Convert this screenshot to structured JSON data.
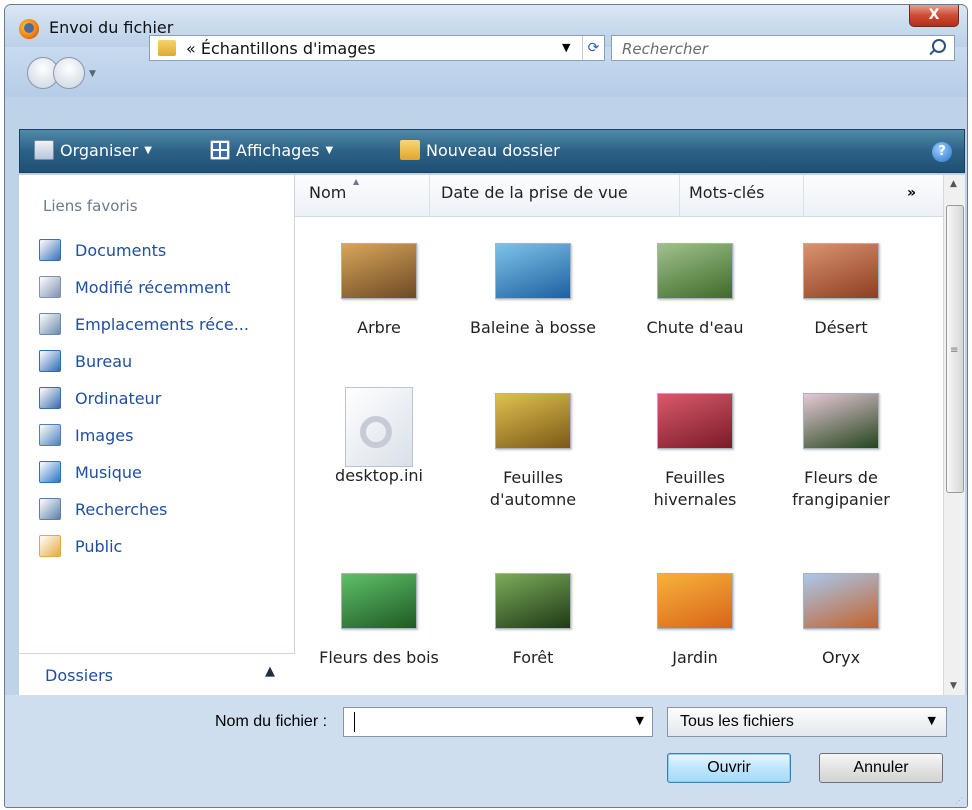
{
  "window": {
    "title": "Envoi du fichier",
    "close_label": "X"
  },
  "address": {
    "prefix": "«",
    "path": "Échantillons d'images",
    "search_placeholder": "Rechercher"
  },
  "toolbar": {
    "organize": "Organiser",
    "views": "Affichages",
    "new_folder": "Nouveau dossier",
    "help": "?"
  },
  "sidebar": {
    "header": "Liens favoris",
    "items": [
      {
        "label": "Documents",
        "icon": "documents-icon"
      },
      {
        "label": "Modifié récemment",
        "icon": "recent-icon"
      },
      {
        "label": "Emplacements réce...",
        "icon": "recent-places-icon"
      },
      {
        "label": "Bureau",
        "icon": "desktop-icon"
      },
      {
        "label": "Ordinateur",
        "icon": "computer-icon"
      },
      {
        "label": "Images",
        "icon": "pictures-icon"
      },
      {
        "label": "Musique",
        "icon": "music-icon"
      },
      {
        "label": "Recherches",
        "icon": "searches-icon"
      },
      {
        "label": "Public",
        "icon": "public-folder-icon"
      }
    ],
    "folders_label": "Dossiers"
  },
  "columns": {
    "name": "Nom",
    "date": "Date de la prise de vue",
    "tags": "Mots-clés",
    "more": "»"
  },
  "files": [
    {
      "label": "Arbre",
      "color1": "#6b4a24",
      "color2": "#d9a55a"
    },
    {
      "label": "Baleine à bosse",
      "color1": "#1f5fa0",
      "color2": "#7cc4e8"
    },
    {
      "label": "Chute d'eau",
      "color1": "#3f6a2a",
      "color2": "#9fc28a"
    },
    {
      "label": "Désert",
      "color1": "#8c3f22",
      "color2": "#d99270"
    },
    {
      "label": "desktop.ini",
      "color1": "",
      "color2": ""
    },
    {
      "label": "Feuilles d'automne",
      "color1": "#7a5a16",
      "color2": "#e0c050"
    },
    {
      "label": "Feuilles hivernales",
      "color1": "#7a1a28",
      "color2": "#d85a6a"
    },
    {
      "label": "Fleurs de frangipanier",
      "color1": "#24451e",
      "color2": "#e6c8d6"
    },
    {
      "label": "Fleurs des bois",
      "color1": "#1f5a22",
      "color2": "#5ec06a"
    },
    {
      "label": "Forêt",
      "color1": "#1e3a16",
      "color2": "#7cab5a"
    },
    {
      "label": "Jardin",
      "color1": "#d8641a",
      "color2": "#f7b23a"
    },
    {
      "label": "Oryx",
      "color1": "#c2622c",
      "color2": "#a9c8ec"
    }
  ],
  "bottom": {
    "filename_label": "Nom du fichier :",
    "filename_value": "",
    "filetype": "Tous les fichiers",
    "open_button": "Ouvrir",
    "cancel_button": "Annuler"
  }
}
